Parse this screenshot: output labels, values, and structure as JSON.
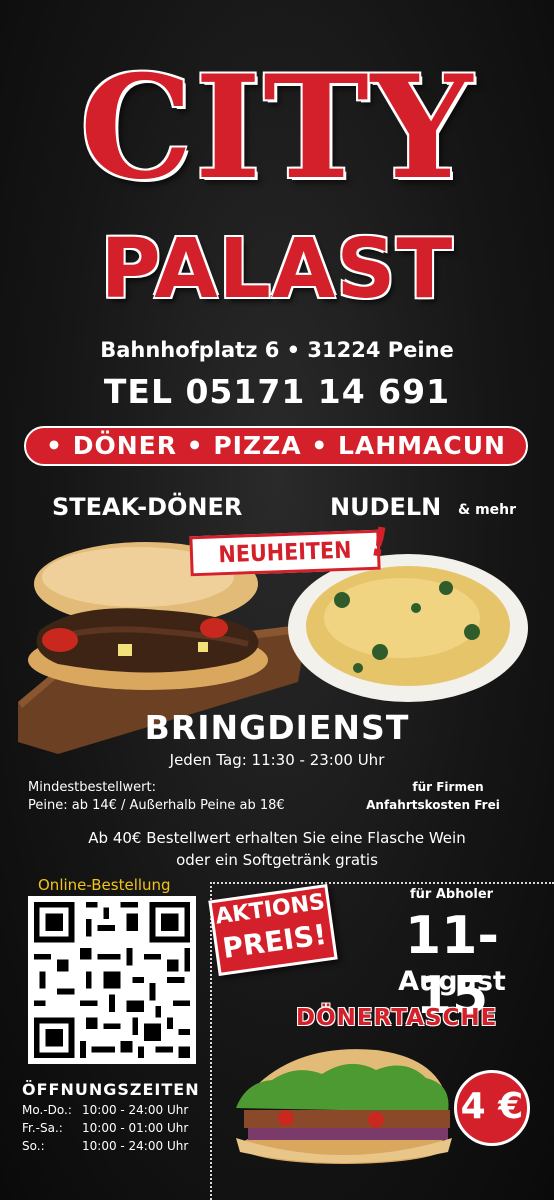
{
  "brand": {
    "line1": "CITY",
    "line2": "PALAST"
  },
  "address": "Bahnhofplatz 6 • 31224 Peine",
  "phone": "TEL 05171 14 691",
  "categories": "• DÖNER • PIZZA • LAHMACUN",
  "products": {
    "left_label": "STEAK-DÖNER",
    "right_label": "NUDELN",
    "right_suffix": "& mehr",
    "badge": "NEUHEITEN",
    "badge_excl": "!"
  },
  "delivery": {
    "title": "BRINGDIENST",
    "hours": "Jeden Tag: 11:30 - 23:00 Uhr",
    "min_label": "Mindestbestellwert:",
    "min_value": "Peine: ab 14€ / Außerhalb Peine ab 18€",
    "firms_label": "für Firmen",
    "firms_value": "Anfahrtskosten Frei",
    "promo_line1": "Ab 40€ Bestellwert erhalten Sie eine Flasche Wein",
    "promo_line2": "oder ein Softgetränk gratis"
  },
  "online": {
    "label": "Online-Bestellung"
  },
  "offer": {
    "badge_line1": "AKTIONS",
    "badge_line2": "PREIS!",
    "audience": "für Abholer",
    "days": "11-15",
    "month": "August",
    "product": "DÖNERTASCHE",
    "price": "4 €"
  },
  "hours": {
    "title": "ÖFFNUNGSZEITEN",
    "rows": [
      {
        "day": "Mo.-Do.:",
        "time": "10:00 - 24:00 Uhr"
      },
      {
        "day": "Fr.-Sa.:",
        "time": "10:00 - 01:00 Uhr"
      },
      {
        "day": "So.:",
        "time": "10:00 - 24:00 Uhr"
      }
    ]
  },
  "colors": {
    "accent": "#d4202a",
    "gold": "#f2c318",
    "background": "#161616"
  }
}
